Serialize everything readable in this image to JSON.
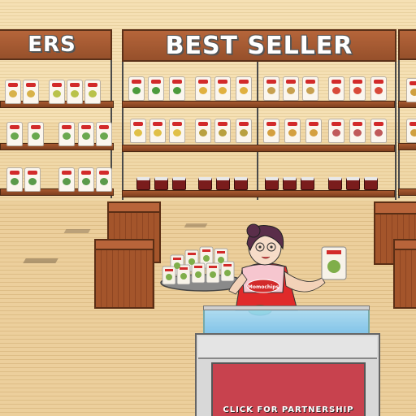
{
  "signs": {
    "left_partial": "ERS",
    "center": "BEST SELLER"
  },
  "counter": {
    "button_label": "CLICK FOR PARTNERSHIP"
  },
  "shopkeeper": {
    "shirt_logo": "Momochips"
  },
  "colors": {
    "sign_wood": "#a85a30",
    "counter_panel": "#c8424e",
    "counter_glass": "#8fd0f5",
    "floor": "#eccf9c"
  }
}
